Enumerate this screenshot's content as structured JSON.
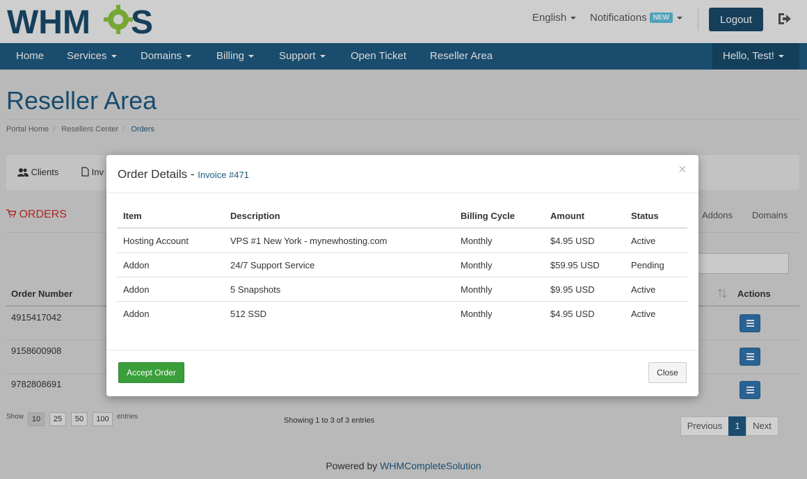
{
  "brand": {
    "logo_text": "WHMCS",
    "colors": {
      "primary": "#1e5a80",
      "accent_green": "#8bc53f",
      "danger": "#c9302c",
      "success": "#3a9e3a"
    }
  },
  "topbar": {
    "language": "English",
    "notifications": "Notifications",
    "notifications_badge": "NEW",
    "logout": "Logout",
    "exit_icon": "sign-out-icon"
  },
  "navbar": {
    "items": [
      {
        "label": "Home",
        "dropdown": false
      },
      {
        "label": "Services",
        "dropdown": true
      },
      {
        "label": "Domains",
        "dropdown": true
      },
      {
        "label": "Billing",
        "dropdown": true
      },
      {
        "label": "Support",
        "dropdown": true
      },
      {
        "label": "Open Ticket",
        "dropdown": false
      },
      {
        "label": "Reseller Area",
        "dropdown": false
      }
    ],
    "user": "Hello, Test!"
  },
  "page": {
    "title": "Reseller Area",
    "breadcrumb": [
      "Portal Home",
      "Resellers Center",
      "Orders"
    ]
  },
  "subnav": {
    "clients": "Clients",
    "invoices_partial": "Inv"
  },
  "orders": {
    "heading": "ORDERS",
    "tabs": [
      "Addons",
      "Domains"
    ],
    "columns": {
      "order_number": "Order Number",
      "actions": "Actions"
    },
    "rows": [
      {
        "order_number": "4915417042"
      },
      {
        "order_number": "9158600908"
      },
      {
        "order_number": "9782808691"
      }
    ],
    "show_label": "Show",
    "page_sizes": [
      "10",
      "25",
      "50",
      "100"
    ],
    "entries_label": "entries",
    "showing": "Showing 1 to 3 of 3 entries",
    "pagination": {
      "previous": "Previous",
      "current": "1",
      "next": "Next"
    }
  },
  "footer": {
    "prefix": "Powered by ",
    "link": "WHMCompleteSolution"
  },
  "modal": {
    "title": "Order Details - ",
    "invoice": "Invoice #471",
    "close_x": "×",
    "columns": [
      "Item",
      "Description",
      "Billing Cycle",
      "Amount",
      "Status"
    ],
    "rows": [
      {
        "item": "Hosting Account",
        "description": "VPS #1 New York - mynewhosting.com",
        "cycle": "Monthly",
        "amount": "$4.95 USD",
        "status": "Active"
      },
      {
        "item": "Addon",
        "description": "24/7 Support Service",
        "cycle": "Monthly",
        "amount": "$59.95 USD",
        "status": "Pending"
      },
      {
        "item": "Addon",
        "description": "5 Snapshots",
        "cycle": "Monthly",
        "amount": "$9.95 USD",
        "status": "Active"
      },
      {
        "item": "Addon",
        "description": "512 SSD",
        "cycle": "Monthly",
        "amount": "$4.95 USD",
        "status": "Active"
      }
    ],
    "accept": "Accept Order",
    "close": "Close"
  }
}
